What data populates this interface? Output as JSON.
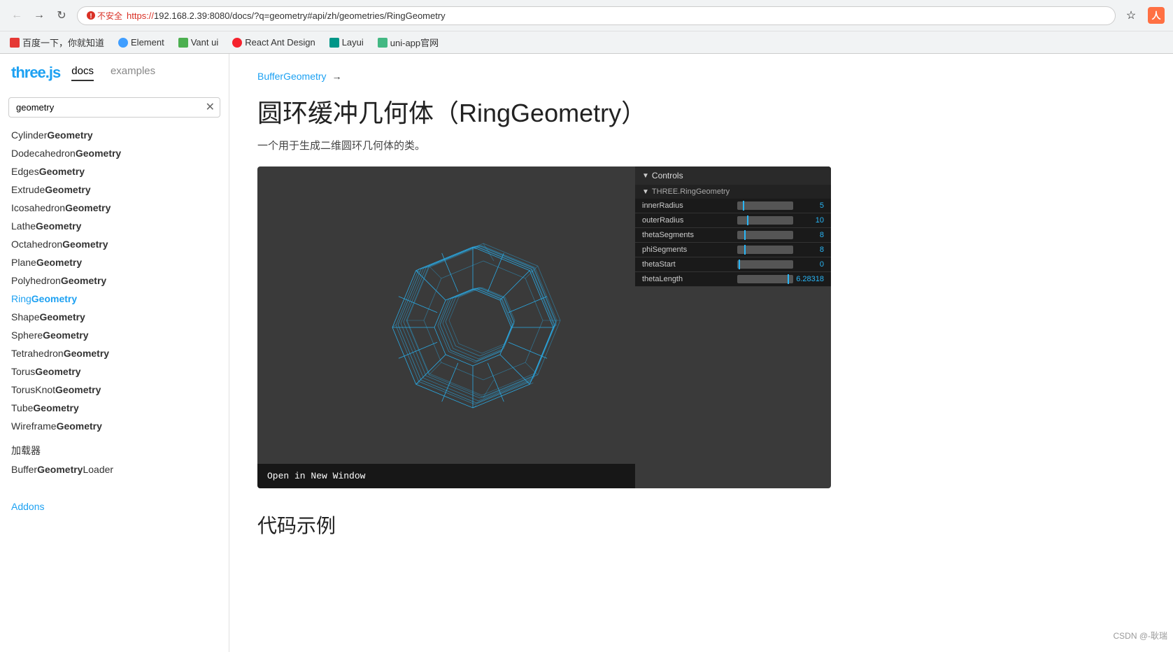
{
  "browser": {
    "url_display": "https://192.168.2.39:8080/docs/?q=geometry#api/zh/geometries/RingGeometry",
    "url_secure_part": "https://",
    "url_insecure_label": "不安全",
    "bookmarks": [
      {
        "label": "百度一下，你就知道",
        "color": "#e53935"
      },
      {
        "label": "Element",
        "color": "#409eff"
      },
      {
        "label": "Vant ui",
        "color": "#4caf50"
      },
      {
        "label": "React Ant Design",
        "color": "#f5222d"
      },
      {
        "label": "Layui",
        "color": "#009688"
      },
      {
        "label": "uni-app官网",
        "color": "#43b883"
      }
    ]
  },
  "sidebar": {
    "logo": "three.js",
    "tabs": [
      {
        "label": "docs",
        "active": true
      },
      {
        "label": "examples",
        "active": false
      }
    ],
    "search_placeholder": "geometry",
    "items": [
      {
        "prefix": "Cylinder",
        "bold": "Geometry",
        "active": false
      },
      {
        "prefix": "Dodecahedron",
        "bold": "Geometry",
        "active": false
      },
      {
        "prefix": "Edges",
        "bold": "Geometry",
        "active": false
      },
      {
        "prefix": "Extrude",
        "bold": "Geometry",
        "active": false
      },
      {
        "prefix": "Icosahedron",
        "bold": "Geometry",
        "active": false
      },
      {
        "prefix": "Lathe",
        "bold": "Geometry",
        "active": false
      },
      {
        "prefix": "Octahedron",
        "bold": "Geometry",
        "active": false
      },
      {
        "prefix": "Plane",
        "bold": "Geometry",
        "active": false
      },
      {
        "prefix": "Polyhedron",
        "bold": "Geometry",
        "active": false
      },
      {
        "prefix": "Ring",
        "bold": "Geometry",
        "active": true
      },
      {
        "prefix": "Shape",
        "bold": "Geometry",
        "active": false
      },
      {
        "prefix": "Sphere",
        "bold": "Geometry",
        "active": false
      },
      {
        "prefix": "Tetrahedron",
        "bold": "Geometry",
        "active": false
      },
      {
        "prefix": "Torus",
        "bold": "Geometry",
        "active": false
      },
      {
        "prefix": "TorusKnot",
        "bold": "Geometry",
        "active": false
      },
      {
        "prefix": "Tube",
        "bold": "Geometry",
        "active": false
      },
      {
        "prefix": "Wireframe",
        "bold": "Geometry",
        "active": false
      }
    ],
    "section_loaders": "加载器",
    "loaders": [
      {
        "prefix": "Buffer",
        "bold": "Geometry",
        "suffix": "Loader",
        "active": false
      }
    ],
    "section_addons": "Addons"
  },
  "main": {
    "breadcrumb": "BufferGeometry",
    "breadcrumb_arrow": "→",
    "page_title": "圆环缓冲几何体（RingGeometry）",
    "page_subtitle": "一个用于生成二维圆环几何体的类。",
    "code_section_title": "代码示例",
    "open_new_window": "Open in New Window",
    "controls": {
      "title": "Controls",
      "sub_title": "THREE.RingGeometry",
      "params": [
        {
          "label": "innerRadius",
          "value": "5",
          "slider_pct": 10
        },
        {
          "label": "outerRadius",
          "value": "10",
          "slider_pct": 20
        },
        {
          "label": "thetaSegments",
          "value": "8",
          "slider_pct": 15
        },
        {
          "label": "phiSegments",
          "value": "8",
          "slider_pct": 15
        },
        {
          "label": "thetaStart",
          "value": "0",
          "slider_pct": 0
        },
        {
          "label": "thetaLength",
          "value": "6.28318",
          "slider_pct": 95
        }
      ]
    }
  },
  "watermark": "CSDN @-耿瑞"
}
